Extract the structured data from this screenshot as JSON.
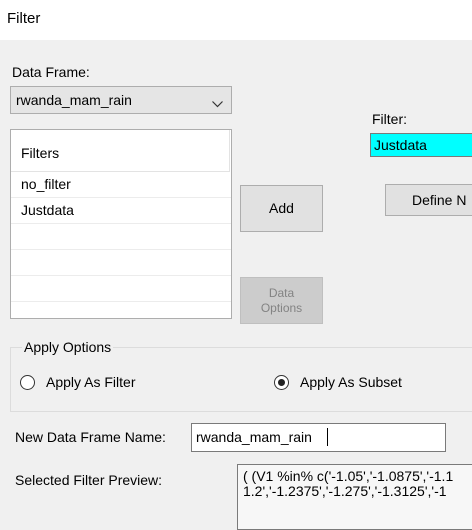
{
  "window": {
    "title": "Filter"
  },
  "data_frame": {
    "label": "Data Frame:",
    "selected": "rwanda_mam_rain"
  },
  "filters_list": {
    "header": "Filters",
    "items": [
      "no_filter",
      "Justdata",
      "",
      "",
      ""
    ]
  },
  "buttons": {
    "add": "Add",
    "data_options_line1": "Data",
    "data_options_line2": "Options",
    "define_new": "Define N"
  },
  "filter": {
    "label": "Filter:",
    "value": "Justdata"
  },
  "apply_options": {
    "title": "Apply Options",
    "as_filter": "Apply As Filter",
    "as_subset": "Apply As Subset",
    "selected": "subset"
  },
  "new_data_frame": {
    "label": "New Data Frame Name:",
    "value": "rwanda_mam_rain"
  },
  "preview": {
    "label": "Selected Filter Preview:",
    "line1": "( (V1 %in% c('-1.05','-1.0875','-1.1",
    "line2": "1.2','-1.2375','-1.275','-1.3125','-1"
  }
}
